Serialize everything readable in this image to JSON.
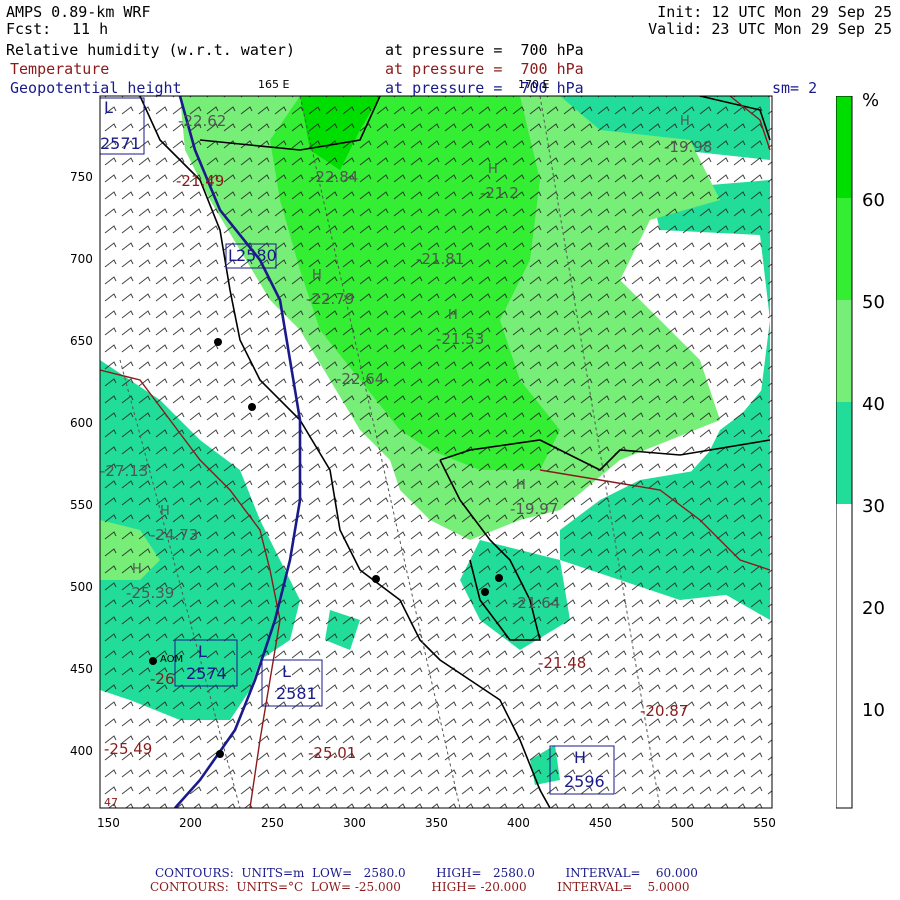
{
  "header": {
    "model": "AMPS 0.89-km WRF",
    "fcst_label": "Fcst:",
    "fcst_value": "11 h",
    "init": "Init: 12 UTC Mon 29 Sep 25",
    "valid": "Valid: 23 UTC Mon 29 Sep 25",
    "fields": [
      {
        "name": "Relative humidity (w.r.t. water)",
        "level": "at pressure =  700 hPa",
        "color": "#000000"
      },
      {
        "name": "Temperature",
        "level": "at pressure =  700 hPa",
        "color": "#8b1a1a"
      },
      {
        "name": "Geopotential height",
        "level": "at pressure =  700 hPa",
        "color": "#1a1a8b"
      }
    ],
    "lon_marker_1": "165 E",
    "lon_marker_2": "170 E",
    "smoothing": "sm= 2"
  },
  "colorbar": {
    "unit": "%",
    "ticks": [
      "60",
      "50",
      "40",
      "30",
      "20",
      "10"
    ],
    "colors": [
      "#00dd00",
      "#33ee33",
      "#77ee77",
      "#22dd99",
      "#ffffff"
    ]
  },
  "axes": {
    "x_ticks": [
      "150",
      "200",
      "250",
      "300",
      "350",
      "400",
      "450",
      "500",
      "550"
    ],
    "y_ticks": [
      "750",
      "700",
      "650",
      "600",
      "550",
      "500",
      "450",
      "400"
    ]
  },
  "map_labels": {
    "height_lows_highs": [
      {
        "kind": "L",
        "value": "2571"
      },
      {
        "kind": "L",
        "value": "2580"
      },
      {
        "kind": "L",
        "value": "2574"
      },
      {
        "kind": "L",
        "value": "2581"
      },
      {
        "kind": "H",
        "value": "2596"
      }
    ],
    "temperature": [
      {
        "kind": "L",
        "value": "-22.62"
      },
      {
        "kind": "L",
        "value": "-21.49"
      },
      {
        "kind": "L",
        "value": "-22.84"
      },
      {
        "kind": "H",
        "value": "-19.98"
      },
      {
        "kind": "H",
        "value": "-21.2"
      },
      {
        "kind": "L",
        "value": "-21.81"
      },
      {
        "kind": "H",
        "value": "-22.79"
      },
      {
        "kind": "H",
        "value": "-21.53"
      },
      {
        "kind": "L",
        "value": "-22.64"
      },
      {
        "kind": "L",
        "value": "-27.13"
      },
      {
        "kind": "H",
        "value": "-19.97"
      },
      {
        "kind": "H",
        "value": "-24.73"
      },
      {
        "kind": "H",
        "value": "-25.39"
      },
      {
        "kind": "L",
        "value": "-21.64"
      },
      {
        "kind": "L",
        "value": "-21.48"
      },
      {
        "kind": "L",
        "value": "-20.87"
      },
      {
        "kind": "L",
        "value": "-25.01"
      },
      {
        "kind": "H",
        "value": "-25.49"
      },
      {
        "kind": "L",
        "value": "-26"
      },
      {
        "kind": "H",
        "value": "47"
      }
    ],
    "station": "AOM"
  },
  "footer": {
    "line1": "CONTOURS:  UNITS=m  LOW=   2580.0        HIGH=   2580.0        INTERVAL=    60.000",
    "line2": "CONTOURS:  UNITS=°C  LOW= -25.000        HIGH= -20.000        INTERVAL=    5.0000",
    "line1_color": "#1a1a8b",
    "line2_color": "#8b1a1a"
  }
}
